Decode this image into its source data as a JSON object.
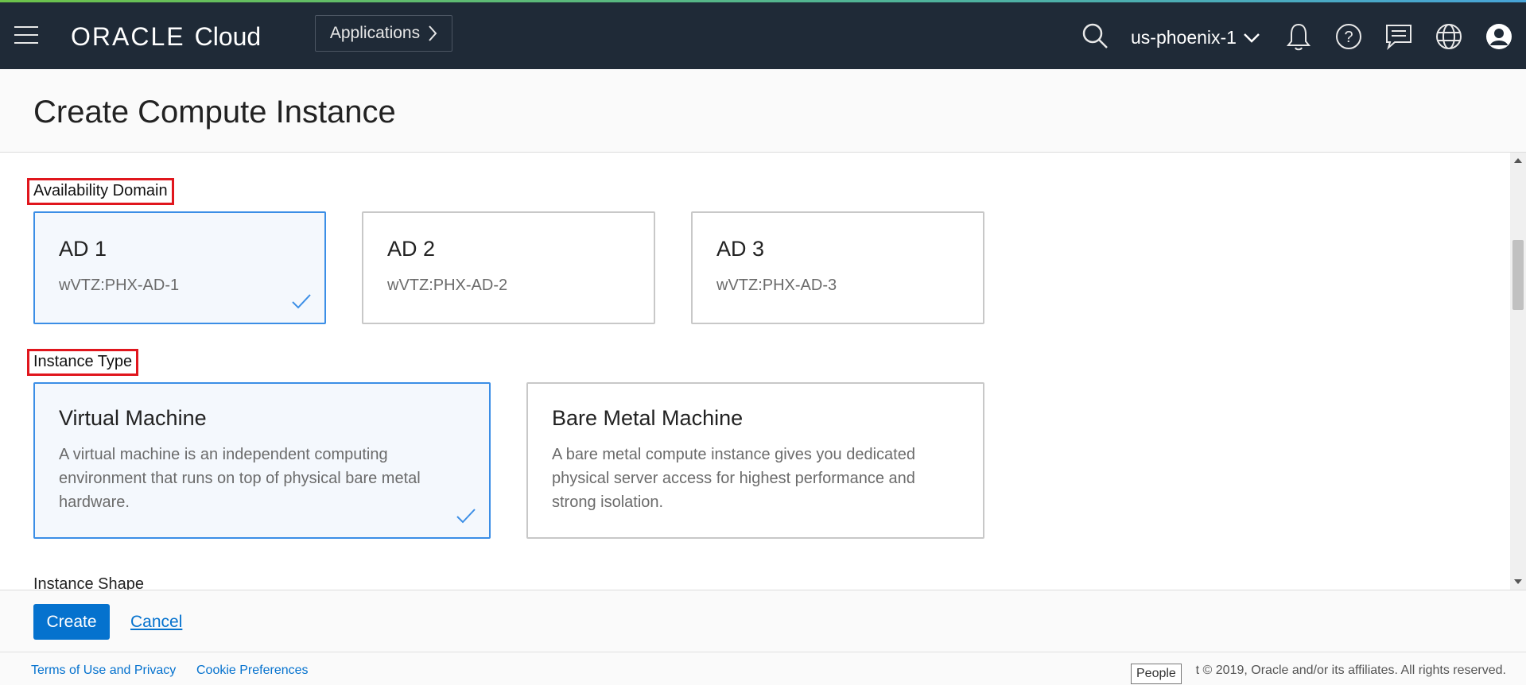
{
  "topbar": {
    "logo_oracle": "ORACLE",
    "logo_cloud": "Cloud",
    "applications_label": "Applications",
    "region": "us-phoenix-1"
  },
  "page": {
    "title": "Create Compute Instance"
  },
  "availability_domain": {
    "label": "Availability Domain",
    "options": [
      {
        "title": "AD 1",
        "subtitle": "wVTZ:PHX-AD-1",
        "selected": true
      },
      {
        "title": "AD 2",
        "subtitle": "wVTZ:PHX-AD-2",
        "selected": false
      },
      {
        "title": "AD 3",
        "subtitle": "wVTZ:PHX-AD-3",
        "selected": false
      }
    ]
  },
  "instance_type": {
    "label": "Instance Type",
    "options": [
      {
        "title": "Virtual Machine",
        "description": "A virtual machine is an independent computing environment that runs on top of physical bare metal hardware.",
        "selected": true
      },
      {
        "title": "Bare Metal Machine",
        "description": "A bare metal compute instance gives you dedicated physical server access for highest performance and strong isolation.",
        "selected": false
      }
    ]
  },
  "instance_shape": {
    "label": "Instance Shape"
  },
  "actions": {
    "create_label": "Create",
    "cancel_label": "Cancel"
  },
  "footer": {
    "terms_label": "Terms of Use and Privacy",
    "cookie_label": "Cookie Preferences",
    "copyright": "t © 2019, Oracle and/or its affiliates. All rights reserved.",
    "tooltip": "People"
  },
  "colors": {
    "topbar_bg": "#1f2a37",
    "accent_blue": "#0572ce",
    "selected_border": "#3b8ee6",
    "highlight_red": "#e0161d"
  }
}
